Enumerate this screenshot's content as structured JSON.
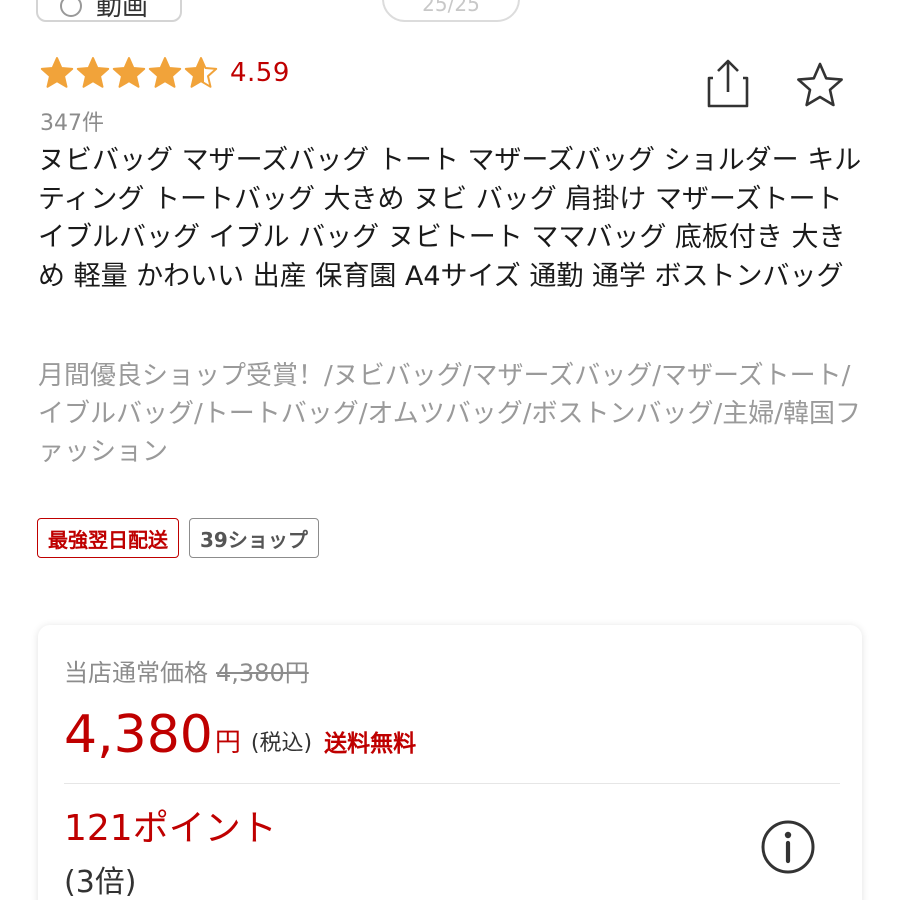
{
  "top_controls": {
    "video_label": "動画",
    "image_counter": "25/25"
  },
  "rating": {
    "value": "4.59",
    "stars_filled": 4.59,
    "review_count": "347件"
  },
  "icons": {
    "share": "share-icon",
    "favorite": "star-outline-icon",
    "info": "info-circle-icon",
    "play": "play-circle-icon"
  },
  "product": {
    "title": "ヌビバッグ マザーズバッグ トート マザーズバッグ ショルダー キルティング トートバッグ 大きめ ヌビ バッグ 肩掛け マザーズトート イブルバッグ イブル バッグ ヌビトート ママバッグ 底板付き 大きめ 軽量 かわいい 出産 保育園 A4サイズ 通勤 通学 ボストンバッグ",
    "catchcopy": "月間優良ショップ受賞！/ヌビバッグ/マザーズバッグ/マザーズトート/イブルバッグ/トートバッグ/オムツバッグ/ボストンバッグ/主婦/韓国ファッション"
  },
  "badges": [
    {
      "label": "最強翌日配送",
      "color": "#bf0000"
    },
    {
      "label": "39ショップ",
      "color": "#555555"
    }
  ],
  "price": {
    "regular_label": "当店通常価格",
    "regular_value": "4,380円",
    "current": "4,380",
    "currency": "円",
    "tax_note": "(税込)",
    "shipping": "送料無料"
  },
  "points": {
    "earned": "121ポイント",
    "multiplier": "(3倍)"
  },
  "colors": {
    "accent_red": "#bf0000",
    "star_gold": "#f1a33a",
    "muted_text": "#8c8c8c"
  }
}
